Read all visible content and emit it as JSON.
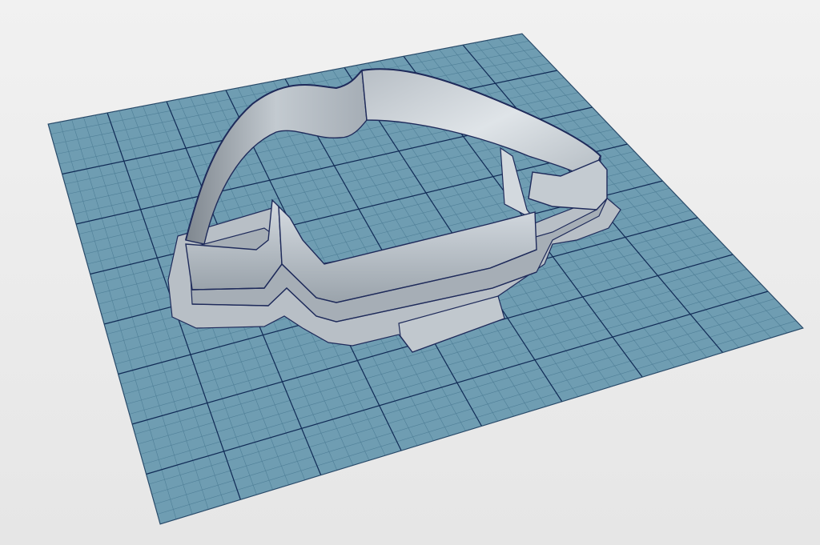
{
  "scene": {
    "subject": "cookie-cutter-3d-model",
    "colors": {
      "background": "#ececec",
      "grid_plate": "#6f9db2",
      "grid_minor_line": "#4f7f97",
      "grid_major_line": "#102a55",
      "model_light": "#c9d0d6",
      "model_mid": "#a9b1b9",
      "model_dark": "#7e868e",
      "model_edge": "#1e2a5a"
    }
  }
}
